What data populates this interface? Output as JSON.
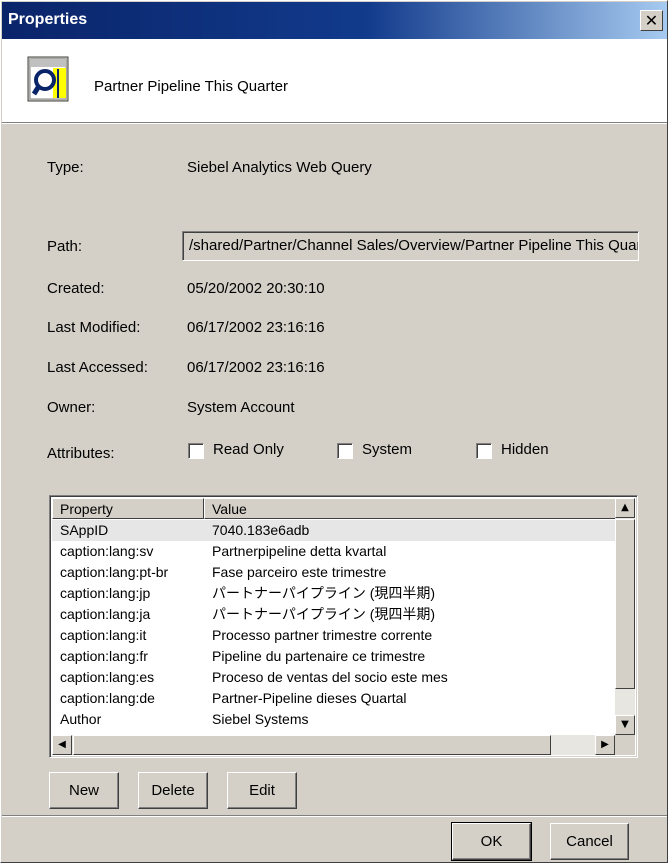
{
  "window": {
    "title": "Properties",
    "close_glyph": "✕"
  },
  "header": {
    "icon": "document-query-icon",
    "title": "Partner Pipeline This Quarter"
  },
  "fields": {
    "type_label": "Type:",
    "type_value": "Siebel Analytics Web Query",
    "path_label": "Path:",
    "path_value": "/shared/Partner/Channel Sales/Overview/Partner Pipeline This Quarter",
    "created_label": "Created:",
    "created_value": "05/20/2002 20:30:10",
    "modified_label": "Last Modified:",
    "modified_value": "06/17/2002 23:16:16",
    "accessed_label": "Last Accessed:",
    "accessed_value": "06/17/2002 23:16:16",
    "owner_label": "Owner:",
    "owner_value": "System Account",
    "attributes_label": "Attributes:"
  },
  "attributes": {
    "read_only": {
      "label": "Read Only",
      "checked": false
    },
    "system": {
      "label": "System",
      "checked": false
    },
    "hidden": {
      "label": "Hidden",
      "checked": false
    }
  },
  "list": {
    "columns": [
      "Property",
      "Value"
    ],
    "rows": [
      {
        "property": "SAppID",
        "value": "7040.183e6adb",
        "selected": true
      },
      {
        "property": "caption:lang:sv",
        "value": "Partnerpipeline detta kvartal"
      },
      {
        "property": "caption:lang:pt-br",
        "value": "Fase parceiro este trimestre"
      },
      {
        "property": "caption:lang:jp",
        "value": "パートナーパイプライン (現四半期)"
      },
      {
        "property": "caption:lang:ja",
        "value": "パートナーパイプライン (現四半期)"
      },
      {
        "property": "caption:lang:it",
        "value": "Processo partner trimestre corrente"
      },
      {
        "property": "caption:lang:fr",
        "value": "Pipeline du partenaire ce trimestre"
      },
      {
        "property": "caption:lang:es",
        "value": "Proceso de ventas del socio este mes"
      },
      {
        "property": "caption:lang:de",
        "value": "Partner-Pipeline dieses Quartal"
      },
      {
        "property": "Author",
        "value": "Siebel Systems"
      }
    ]
  },
  "buttons": {
    "new": "New",
    "delete": "Delete",
    "edit": "Edit",
    "ok": "OK",
    "cancel": "Cancel"
  },
  "scroll_glyphs": {
    "up": "▲",
    "down": "▼",
    "left": "◀",
    "right": "▶"
  }
}
